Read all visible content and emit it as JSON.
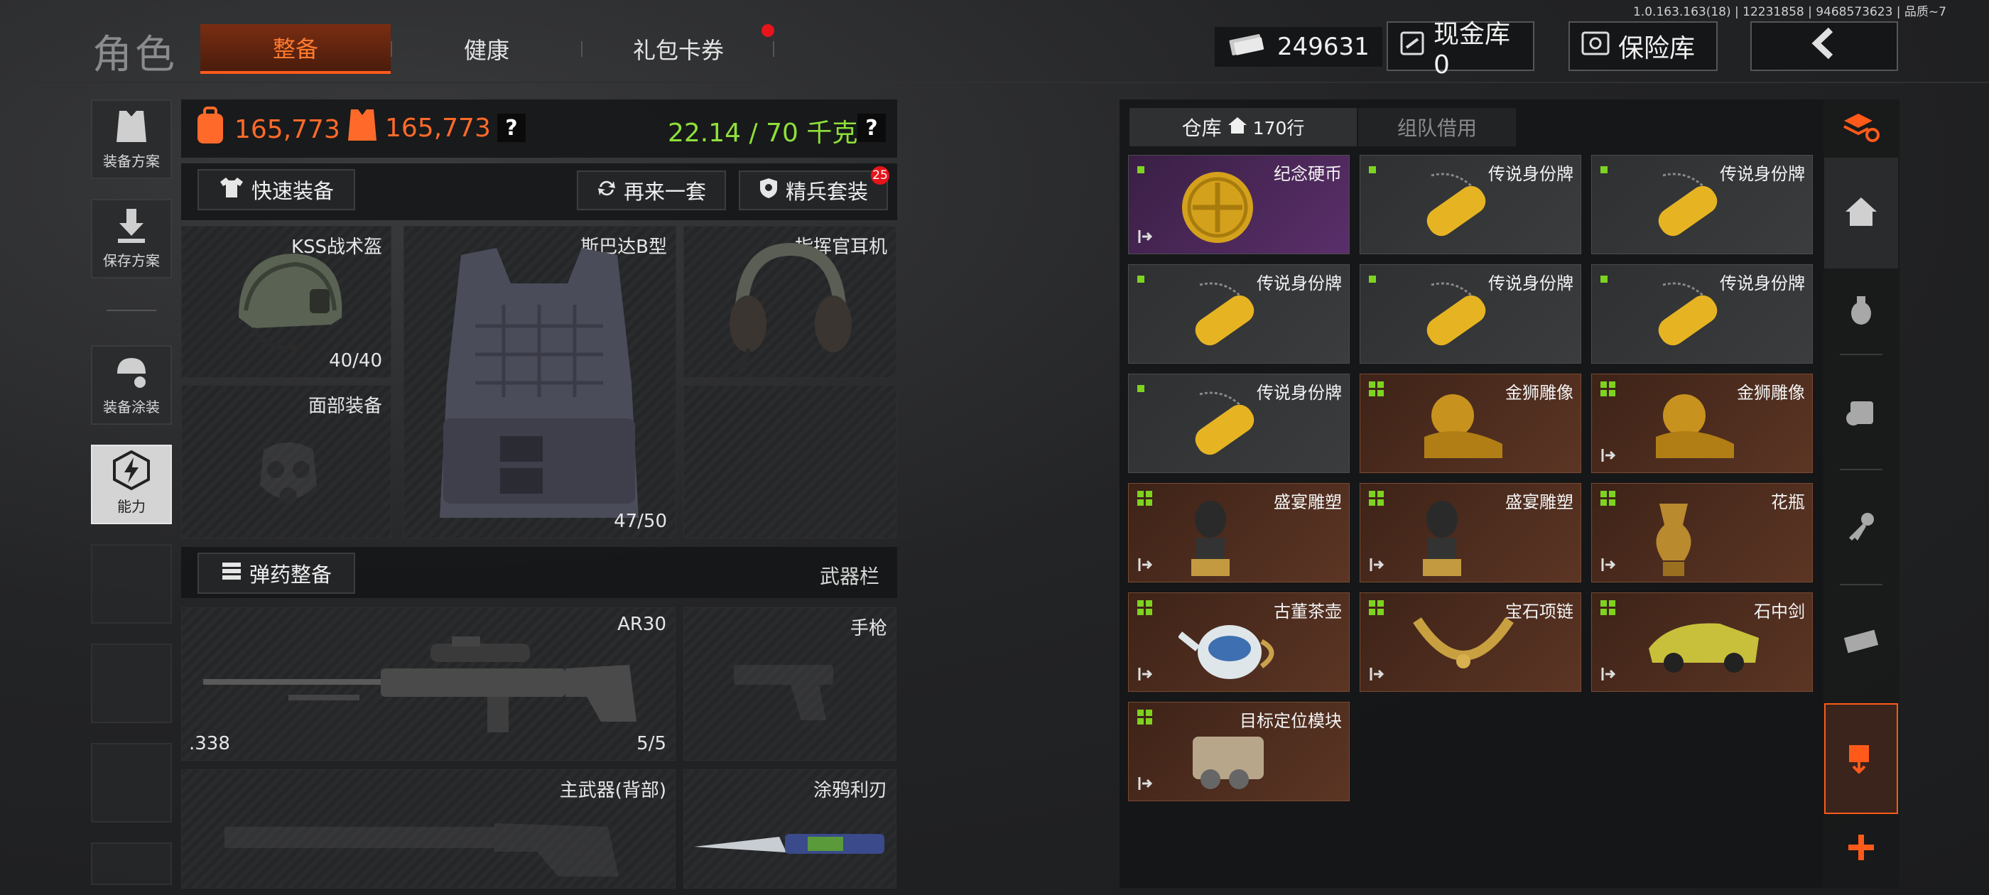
{
  "version": "1.0.163.163(18) | 12231858 | 9468573623 | 品质~7",
  "header": {
    "title": "角色",
    "tabs": [
      {
        "label": "整备"
      },
      {
        "label": "健康"
      },
      {
        "label": "礼包卡券"
      }
    ],
    "money": "249631",
    "cash_vault": "现金库 0",
    "safe_vault": "保险库"
  },
  "left_menu": [
    {
      "label": "装备方案"
    },
    {
      "label": "保存方案"
    },
    {
      "label": "装备涂装"
    },
    {
      "label": "能力"
    }
  ],
  "stats": {
    "value1": "165,773",
    "value2": "165,773",
    "weight": "22.14 / 70 千克"
  },
  "actions": {
    "quick_equip": "快速装备",
    "again": "再来一套",
    "elite": "精兵套装",
    "elite_badge": "25",
    "ammo": "弹药整备",
    "weapons_label": "武器栏"
  },
  "slots": {
    "helmet": {
      "name": "KSS战术盔",
      "dur": "40/40"
    },
    "armor": {
      "name": "斯巴达B型",
      "dur": "47/50"
    },
    "headset": {
      "name": "指挥官耳机"
    },
    "face": {
      "name": "面部装备"
    },
    "rifle": {
      "name": "AR30",
      "ammo": ".338",
      "dur": "5/5"
    },
    "pistol": {
      "name": "手枪"
    },
    "primary_back": {
      "name": "主武器(背部)"
    },
    "knife": {
      "name": "涂鸦利刃"
    }
  },
  "warehouse": {
    "tab1": "仓库",
    "rows": "170行",
    "tab2": "组队借用",
    "items": [
      {
        "name": "纪念硬币",
        "kind": "purple",
        "exit": true
      },
      {
        "name": "传说身份牌",
        "kind": "green",
        "exit": false
      },
      {
        "name": "传说身份牌",
        "kind": "green",
        "exit": false
      },
      {
        "name": "传说身份牌",
        "kind": "green",
        "exit": false
      },
      {
        "name": "传说身份牌",
        "kind": "green",
        "exit": false
      },
      {
        "name": "传说身份牌",
        "kind": "green",
        "exit": false
      },
      {
        "name": "传说身份牌",
        "kind": "green",
        "exit": false
      },
      {
        "name": "金狮雕像",
        "kind": "gold",
        "exit": false
      },
      {
        "name": "金狮雕像",
        "kind": "gold",
        "exit": true
      },
      {
        "name": "盛宴雕塑",
        "kind": "gold",
        "exit": true
      },
      {
        "name": "盛宴雕塑",
        "kind": "gold",
        "exit": true
      },
      {
        "name": "花瓶",
        "kind": "gold",
        "exit": true
      },
      {
        "name": "古董茶壶",
        "kind": "gold",
        "exit": true
      },
      {
        "name": "宝石项链",
        "kind": "gold",
        "exit": true
      },
      {
        "name": "石中剑",
        "kind": "gold",
        "exit": true
      },
      {
        "name": "目标定位模块",
        "kind": "gold",
        "exit": true
      }
    ]
  },
  "colors": {
    "accent": "#ff5a1a",
    "weight_green": "#8ee03a",
    "stat_orange": "#ff6a2a",
    "tag_green": "#7ed321"
  }
}
